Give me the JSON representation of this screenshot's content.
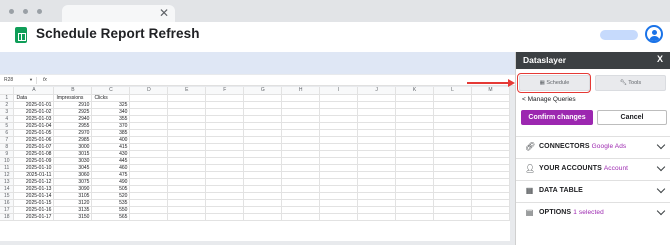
{
  "app": {
    "title": "Schedule Report Refresh",
    "tab_close": "✕"
  },
  "formula_bar": {
    "name_box": "R28",
    "name_box_arrow": "▼",
    "fx": "fx"
  },
  "sheet": {
    "columns": [
      "A",
      "B",
      "C",
      "D",
      "E",
      "F",
      "G",
      "H",
      "I",
      "J",
      "K",
      "L",
      "M"
    ],
    "header_row": [
      "Data",
      "Impressions",
      "Clicks"
    ],
    "rows": [
      [
        "2025-01-01",
        "2910",
        "325"
      ],
      [
        "2025-01-02",
        "2925",
        "340"
      ],
      [
        "2025-01-03",
        "2940",
        "355"
      ],
      [
        "2025-01-04",
        "2955",
        "370"
      ],
      [
        "2025-01-05",
        "2970",
        "385"
      ],
      [
        "2025-01-06",
        "2985",
        "400"
      ],
      [
        "2025-01-07",
        "3000",
        "415"
      ],
      [
        "2025-01-08",
        "3015",
        "430"
      ],
      [
        "2025-01-09",
        "3030",
        "445"
      ],
      [
        "2025-01-10",
        "3045",
        "460"
      ],
      [
        "2025-01-11",
        "3060",
        "475"
      ],
      [
        "2025-01-12",
        "3075",
        "490"
      ],
      [
        "2025-01-13",
        "3090",
        "505"
      ],
      [
        "2025-01-14",
        "3105",
        "520"
      ],
      [
        "2025-01-15",
        "3120",
        "535"
      ],
      [
        "2025-01-16",
        "3135",
        "550"
      ],
      [
        "2025-01-17",
        "3150",
        "565"
      ]
    ]
  },
  "panel": {
    "title": "Dataslayer",
    "close": "X",
    "schedule_label": "Schedule",
    "schedule_icon": "calendar-icon",
    "tools_label": "Tools",
    "tools_icon": "wrench-icon",
    "manage_queries": "< Manage Queries",
    "confirm_label": "Confirm changes",
    "cancel_label": "Cancel",
    "sections": [
      {
        "label": "CONNECTORS",
        "sub": "Google Ads",
        "icon": "link-icon"
      },
      {
        "label": "YOUR ACCOUNTS",
        "sub": "Account",
        "icon": "user-icon"
      },
      {
        "label": "DATA TABLE",
        "sub": "",
        "icon": "table-icon"
      },
      {
        "label": "OPTIONS",
        "sub": "1 selected",
        "icon": "options-icon"
      }
    ]
  },
  "colors": {
    "accent": "#9c27b0",
    "highlight": "#e53935",
    "panel_header": "#3c4043",
    "sheets_green": "#0f9d58"
  }
}
